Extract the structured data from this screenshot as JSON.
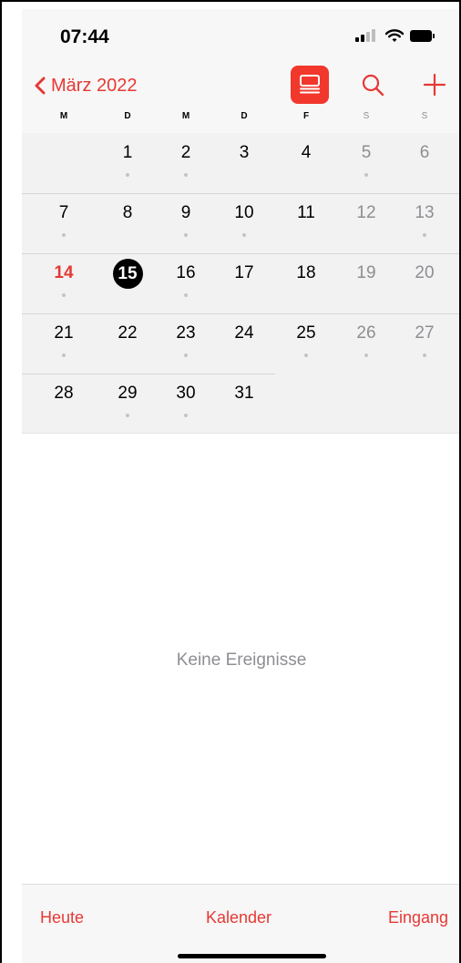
{
  "status_bar": {
    "time": "07:44"
  },
  "nav": {
    "back_label": "März 2022",
    "list_view_icon": "calendar-list-icon",
    "search_icon": "search-icon",
    "add_icon": "plus-icon",
    "accent_color": "#e53935"
  },
  "weekdays": [
    "M",
    "D",
    "M",
    "D",
    "F",
    "S",
    "S"
  ],
  "calendar": {
    "weeks": [
      [
        null,
        "1",
        "2",
        "3",
        "4",
        "5",
        "6"
      ],
      [
        "7",
        "8",
        "9",
        "10",
        "11",
        "12",
        "13"
      ],
      [
        "14",
        "15",
        "16",
        "17",
        "18",
        "19",
        "20"
      ],
      [
        "21",
        "22",
        "23",
        "24",
        "25",
        "26",
        "27"
      ],
      [
        "28",
        "29",
        "30",
        "31",
        null,
        null,
        null
      ]
    ],
    "today": "14",
    "selected": "15",
    "days_with_events": [
      "1",
      "2",
      "5",
      "7",
      "9",
      "10",
      "13",
      "14",
      "16",
      "21",
      "23",
      "25",
      "26",
      "27",
      "29",
      "30"
    ]
  },
  "empty_message": "Keine Ereignisse",
  "toolbar": {
    "today_label": "Heute",
    "calendars_label": "Kalender",
    "inbox_label": "Eingang"
  }
}
